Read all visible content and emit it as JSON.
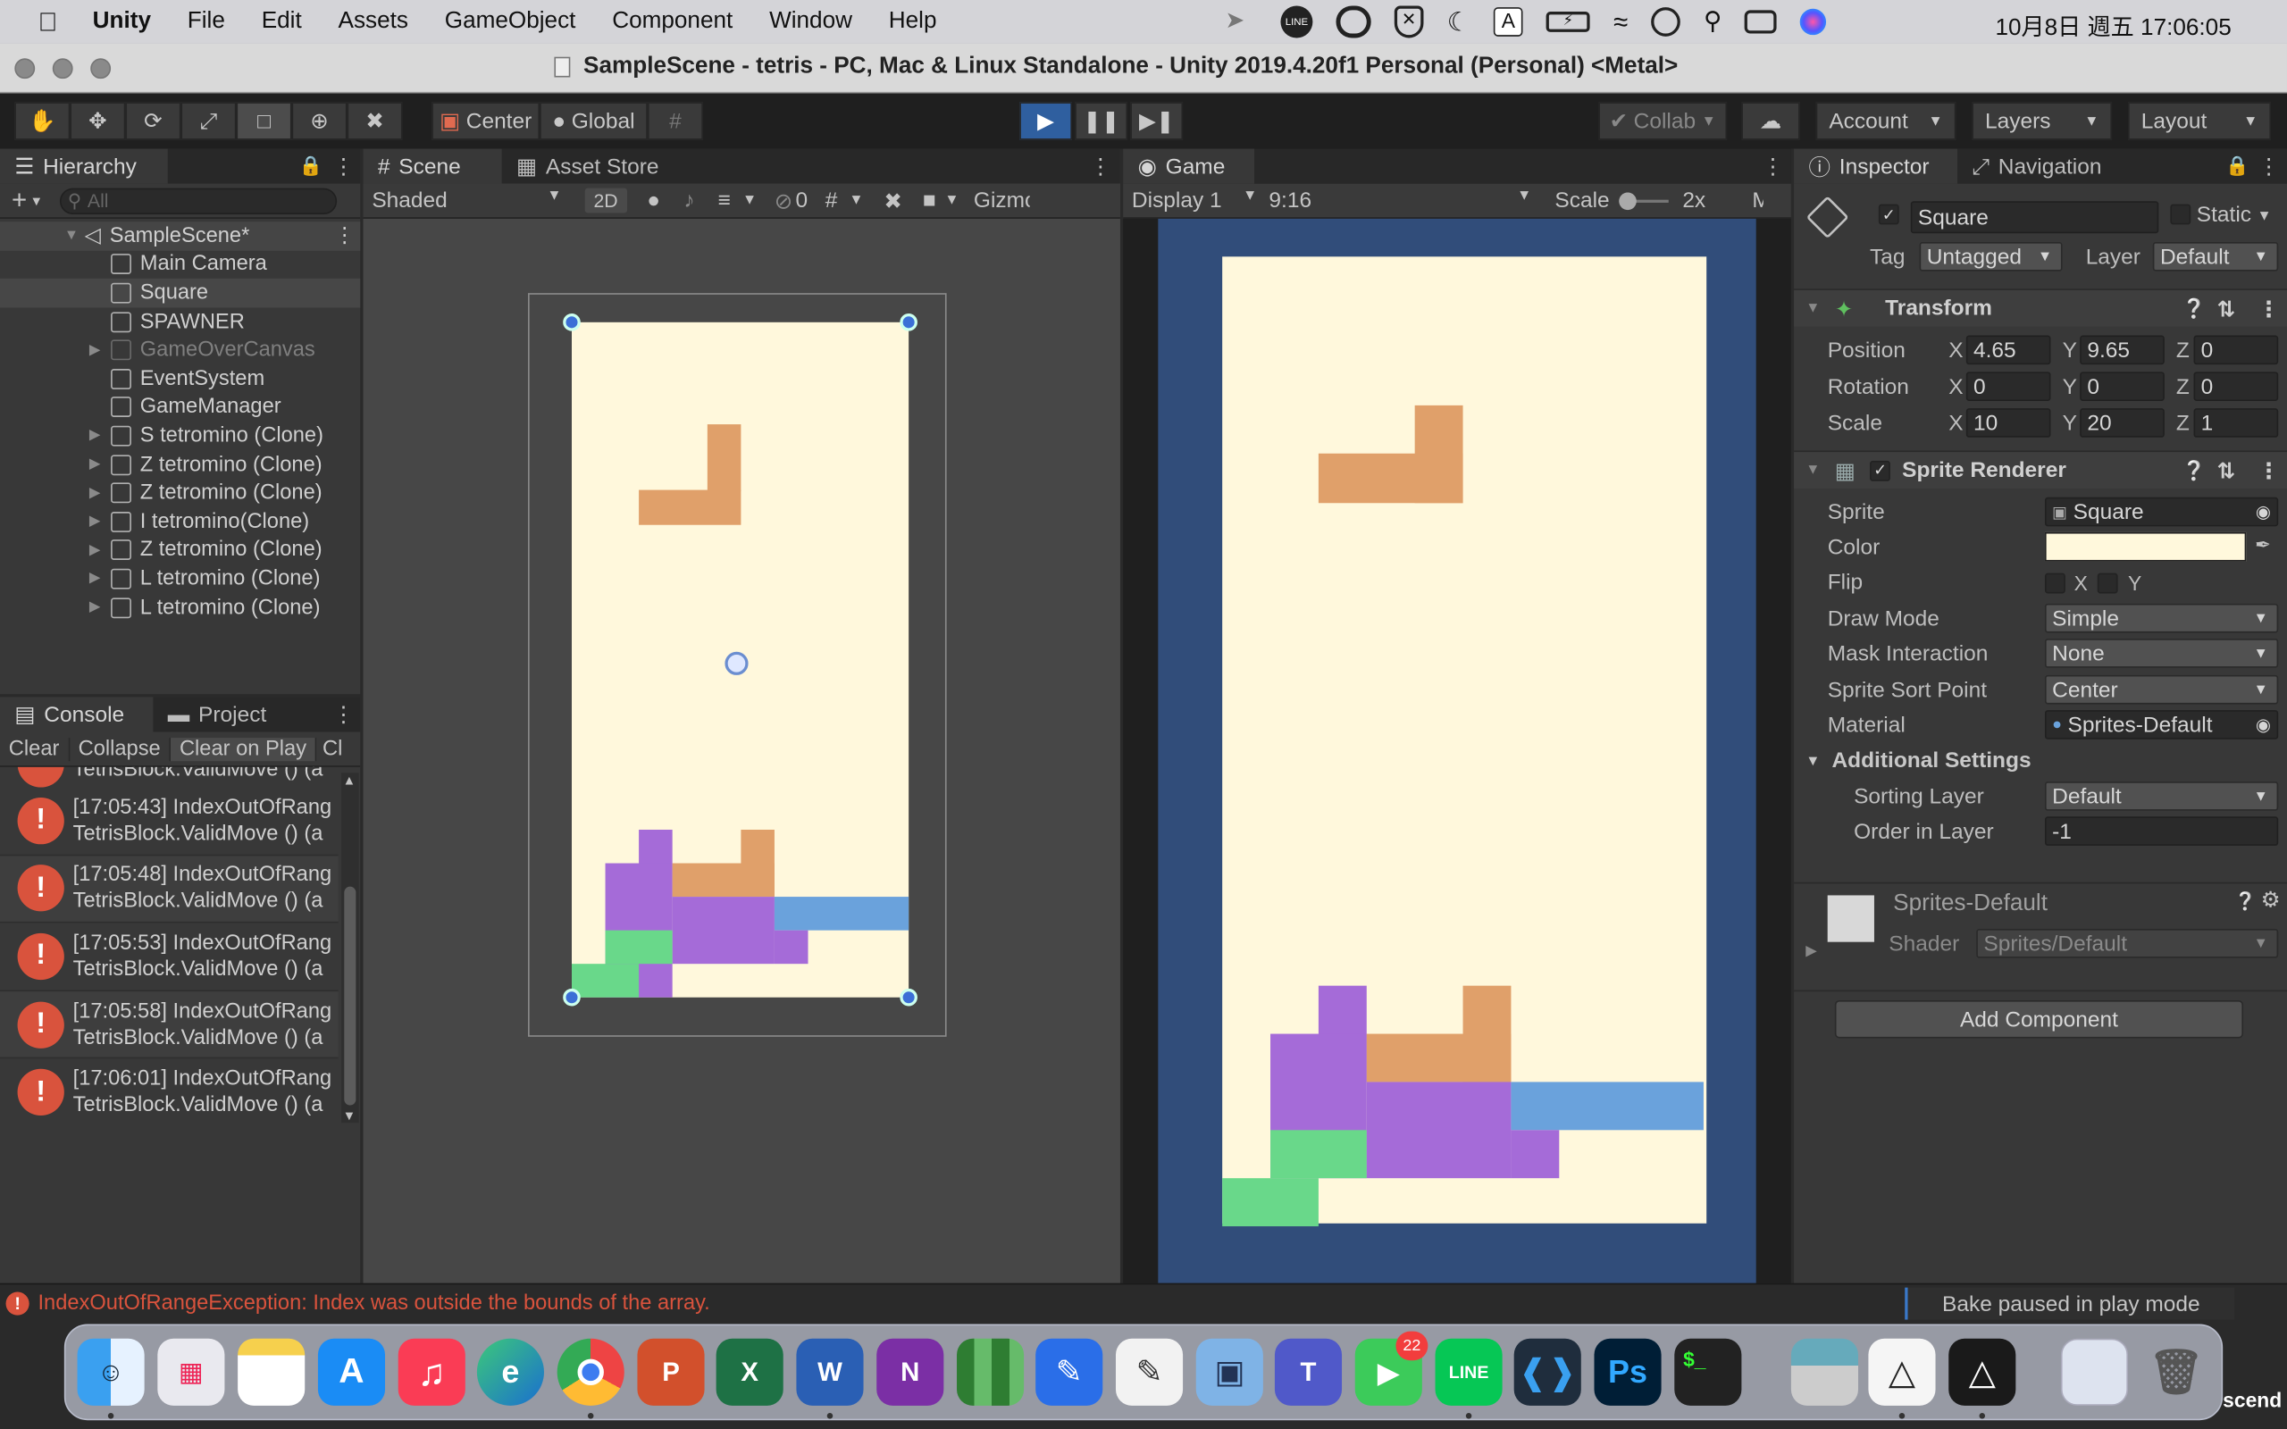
{
  "menubar": {
    "app": "Unity",
    "items": [
      "File",
      "Edit",
      "Assets",
      "GameObject",
      "Component",
      "Window",
      "Help"
    ],
    "clock": "10月8日 週五 17:06:05",
    "status_letter": "A"
  },
  "window": {
    "title": "SampleScene - tetris - PC, Mac & Linux Standalone - Unity 2019.4.20f1 Personal (Personal) <Metal>"
  },
  "toolbar": {
    "pivot": "Center",
    "space": "Global",
    "collab": "Collab",
    "account": "Account",
    "layers": "Layers",
    "layout": "Layout"
  },
  "hierarchy": {
    "tab": "Hierarchy",
    "search_placeholder": "All",
    "scene": "SampleScene*",
    "items": [
      {
        "label": "Main Camera",
        "expandable": false,
        "dim": false
      },
      {
        "label": "Square",
        "expandable": false,
        "dim": false
      },
      {
        "label": "SPAWNER",
        "expandable": false,
        "dim": false
      },
      {
        "label": "GameOverCanvas",
        "expandable": true,
        "dim": true
      },
      {
        "label": "EventSystem",
        "expandable": false,
        "dim": false
      },
      {
        "label": "GameManager",
        "expandable": false,
        "dim": false
      },
      {
        "label": "S tetromino (Clone)",
        "expandable": true,
        "dim": false
      },
      {
        "label": "Z tetromino (Clone)",
        "expandable": true,
        "dim": false
      },
      {
        "label": "Z tetromino (Clone)",
        "expandable": true,
        "dim": false
      },
      {
        "label": "I tetromino(Clone)",
        "expandable": true,
        "dim": false
      },
      {
        "label": "Z tetromino (Clone)",
        "expandable": true,
        "dim": false
      },
      {
        "label": "L tetromino (Clone)",
        "expandable": true,
        "dim": false
      },
      {
        "label": "L tetromino (Clone)",
        "expandable": true,
        "dim": false
      }
    ]
  },
  "console": {
    "tabs": [
      "Console",
      "Project"
    ],
    "buttons": [
      "Clear",
      "Collapse",
      "Clear on Play",
      "Cl"
    ],
    "partial_line": "TetrisBlock.ValidMove () (a",
    "logs": [
      {
        "line1": "[17:05:43] IndexOutOfRang",
        "line2": "TetrisBlock.ValidMove () (a"
      },
      {
        "line1": "[17:05:48] IndexOutOfRang",
        "line2": "TetrisBlock.ValidMove () (a"
      },
      {
        "line1": "[17:05:53] IndexOutOfRang",
        "line2": "TetrisBlock.ValidMove () (a"
      },
      {
        "line1": "[17:05:58] IndexOutOfRang",
        "line2": "TetrisBlock.ValidMove () (a"
      },
      {
        "line1": "[17:06:01] IndexOutOfRang",
        "line2": "TetrisBlock.ValidMove () (a"
      }
    ]
  },
  "scene": {
    "tabs": [
      "Scene",
      "Asset Store"
    ],
    "shading": "Shaded",
    "mode_2d": "2D",
    "hidden_count": "0",
    "gizmos": "Gizmo"
  },
  "game": {
    "tab": "Game",
    "display": "Display 1",
    "aspect": "9:16",
    "scale_label": "Scale",
    "scale_value": "2x",
    "maximize": "M"
  },
  "inspector": {
    "tabs": [
      "Inspector",
      "Navigation"
    ],
    "object_name": "Square",
    "static_label": "Static",
    "tag_label": "Tag",
    "tag": "Untagged",
    "layer_label": "Layer",
    "layer": "Default",
    "transform": {
      "title": "Transform",
      "rows": [
        {
          "label": "Position",
          "x": "4.65",
          "y": "9.65",
          "z": "0"
        },
        {
          "label": "Rotation",
          "x": "0",
          "y": "0",
          "z": "0"
        },
        {
          "label": "Scale",
          "x": "10",
          "y": "20",
          "z": "1"
        }
      ]
    },
    "sprite_renderer": {
      "title": "Sprite Renderer",
      "sprite_label": "Sprite",
      "sprite": "Square",
      "color_label": "Color",
      "color": "#fff8dc",
      "flip_label": "Flip",
      "flip_x": "X",
      "flip_y": "Y",
      "draw_mode_label": "Draw Mode",
      "draw_mode": "Simple",
      "mask_label": "Mask Interaction",
      "mask": "None",
      "sort_point_label": "Sprite Sort Point",
      "sort_point": "Center",
      "material_label": "Material",
      "material": "Sprites-Default",
      "additional": "Additional Settings",
      "sorting_layer_label": "Sorting Layer",
      "sorting_layer": "Default",
      "order_label": "Order in Layer",
      "order": "-1"
    },
    "material_asset": {
      "name": "Sprites-Default",
      "shader_label": "Shader",
      "shader": "Sprites/Default"
    },
    "add_component": "Add Component"
  },
  "statusbar": {
    "error": "IndexOutOfRangeException: Index was outside the bounds of the array.",
    "bake": "Bake paused in play mode"
  },
  "dock": {
    "facetime_badge": "22",
    "partial_label": "scend"
  },
  "colors": {
    "board_bg": "#fff8dc",
    "camera_bg": "#314d7a",
    "orange": "#e0a06a",
    "purple": "#a56bd8",
    "blue": "#6aa2dc",
    "green": "#69d88a",
    "error": "#d9533d"
  }
}
